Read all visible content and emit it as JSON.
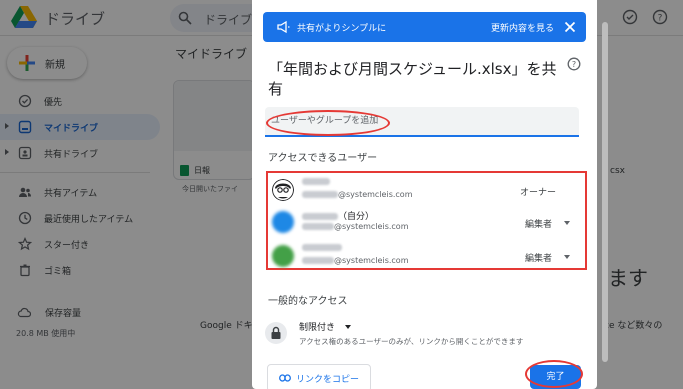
{
  "app": {
    "title": "ドライブ",
    "search_placeholder": "ドライブ",
    "new_label": "新規",
    "main_title": "マイドライブ"
  },
  "sidebar": {
    "items": [
      {
        "label": "優先",
        "icon": "check-circle-icon"
      },
      {
        "label": "マイドライブ",
        "icon": "drive-icon"
      },
      {
        "label": "共有ドライブ",
        "icon": "shared-drive-icon"
      },
      {
        "label": "共有アイテム",
        "icon": "people-icon"
      },
      {
        "label": "最近使用したアイテム",
        "icon": "clock-icon"
      },
      {
        "label": "スター付き",
        "icon": "star-icon"
      },
      {
        "label": "ゴミ箱",
        "icon": "trash-icon"
      }
    ],
    "storage_label": "保存容量",
    "storage_used": "20.8 MB 使用中"
  },
  "background": {
    "card_name": "日報",
    "card_sub": "今日開いたファイ",
    "card2_name": "csx",
    "promo_left": "Google ドキ",
    "promo_right": "ce など数々の",
    "big_text": "ます"
  },
  "dialog": {
    "banner_text": "共有がよりシンプルに",
    "banner_link": "更新内容を見る",
    "title": "「年間および月間スケジュール.xlsx」を共有",
    "add_placeholder": "ユーザーやグループを追加",
    "people_label": "アクセスできるユーザー",
    "users": [
      {
        "email_domain": "@systemcleis.com",
        "role": "オーナー",
        "has_dropdown": false,
        "avatar_color": "#202124"
      },
      {
        "name_suffix": "（自分）",
        "email_domain": "@systemcleis.com",
        "role": "編集者",
        "has_dropdown": true,
        "avatar_color": "#1e88e5"
      },
      {
        "email_domain": "@systemcleis.com",
        "role": "編集者",
        "has_dropdown": true,
        "avatar_color": "#43a047"
      }
    ],
    "general_label": "一般的なアクセス",
    "access_value": "制限付き",
    "access_desc": "アクセス権のあるユーザーのみが、リンクから開くことができます",
    "copy_link": "リンクをコピー",
    "done": "完了"
  },
  "colors": {
    "accent": "#1a73e8",
    "annotation": "#e53935"
  }
}
